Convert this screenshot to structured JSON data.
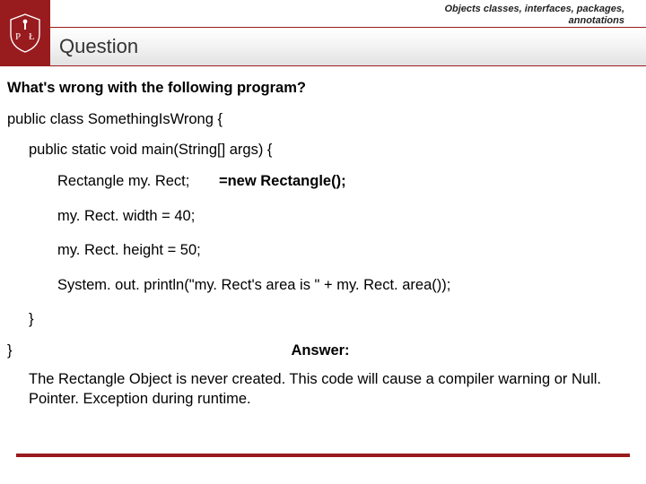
{
  "header": {
    "breadcrumb_line1": "Objects classes, interfaces, packages,",
    "breadcrumb_line2": "annotations",
    "title": "Question"
  },
  "question": {
    "heading": "What's wrong with the following program?",
    "code": {
      "l1": "public class SomethingIsWrong {",
      "l2": "public static void main(String[] args) {",
      "l3a": "Rectangle my. Rect;",
      "l3b": "=new Rectangle();",
      "l4": "my. Rect. width = 40;",
      "l5": "my. Rect. height = 50;",
      "l6": "System. out. println(\"my. Rect's area is \" + my. Rect. area());",
      "l7": "}",
      "l8": "}"
    }
  },
  "answer": {
    "label": "Answer:",
    "text": "The Rectangle Object is never created. This code will cause a compiler warning or Null. Pointer. Exception during runtime."
  }
}
